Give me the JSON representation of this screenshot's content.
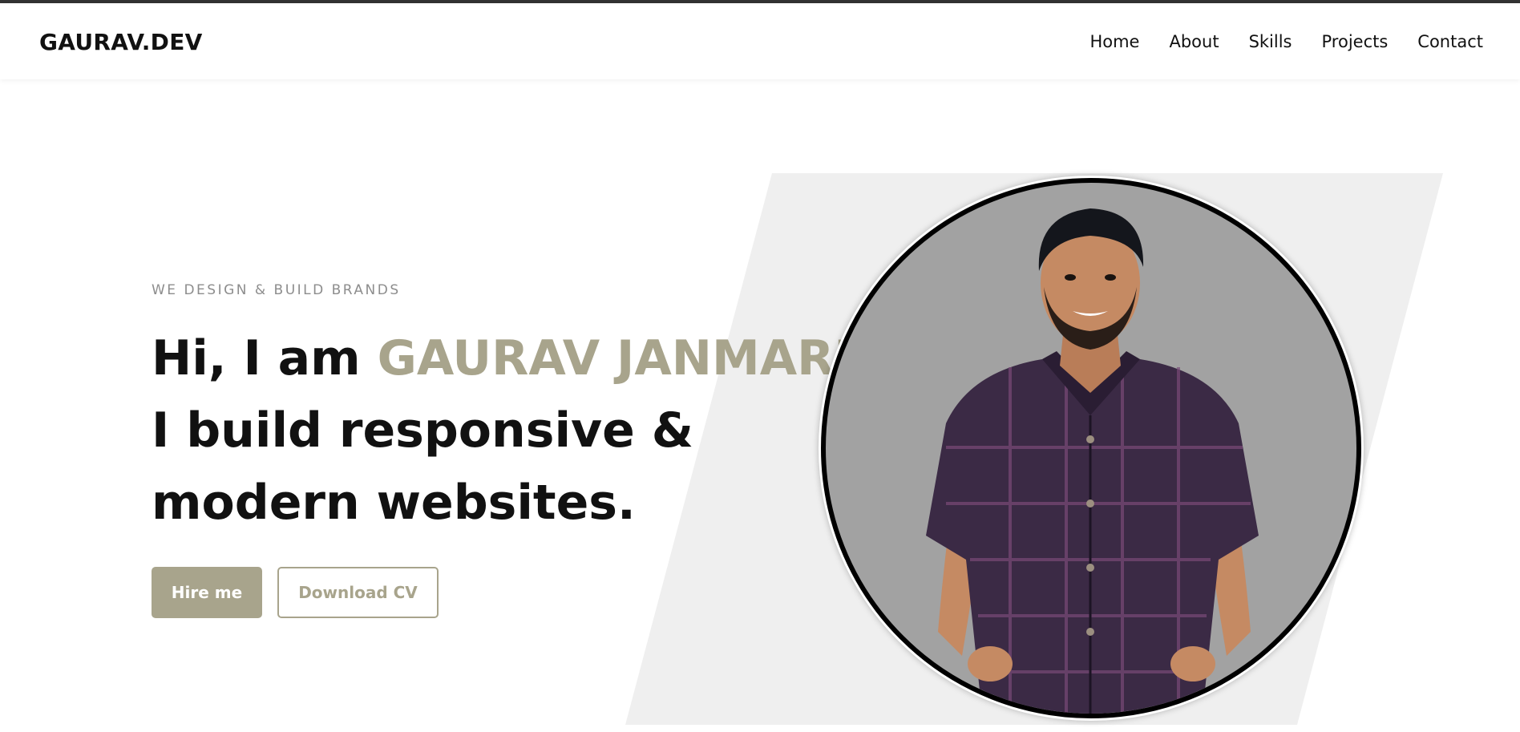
{
  "brand": {
    "logo": "GAURAV.DEV"
  },
  "nav": {
    "items": [
      "Home",
      "About",
      "Skills",
      "Projects",
      "Contact"
    ]
  },
  "hero": {
    "tagline": "WE DESIGN & BUILD BRANDS",
    "greeting": "Hi, I am ",
    "name": "GAURAV JANMARE",
    "line2": "I build responsive &",
    "line3": "modern websites.",
    "hire_label": "Hire me",
    "cv_label": "Download CV"
  },
  "colors": {
    "accent": "#a8a48c",
    "text": "#111111",
    "muted": "#8d8d8d",
    "shape_bg": "#efefef",
    "photo_bg": "#a2a2a2"
  }
}
